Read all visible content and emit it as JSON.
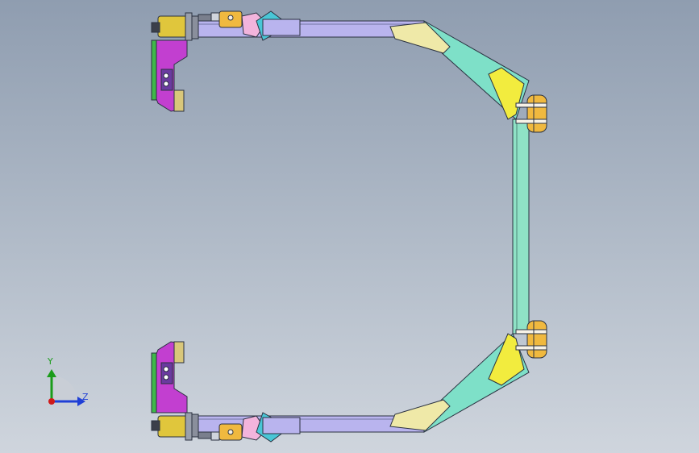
{
  "viewport": {
    "background_top": "#8f9db0",
    "background_bottom": "#cfd5dd"
  },
  "triad": {
    "y_label": "Y",
    "z_label": "Z",
    "colors": {
      "y": "#1a9c1a",
      "z": "#1f3fd6",
      "x": "#d01a1a"
    }
  },
  "model": {
    "colors": {
      "frame_side": "#b9b4ee",
      "frame_diag": "#7ee0c8",
      "frame_vertical": "#8fe2c6",
      "gusset": "#f2ec3e",
      "pad": "#efe9a8",
      "bracket": "#f0b93f",
      "clamp_body": "#c23fd0",
      "cylinder": "#e0c63c",
      "hinge_pink": "#f2b4dc",
      "hinge_cyan": "#49c6d6"
    }
  }
}
